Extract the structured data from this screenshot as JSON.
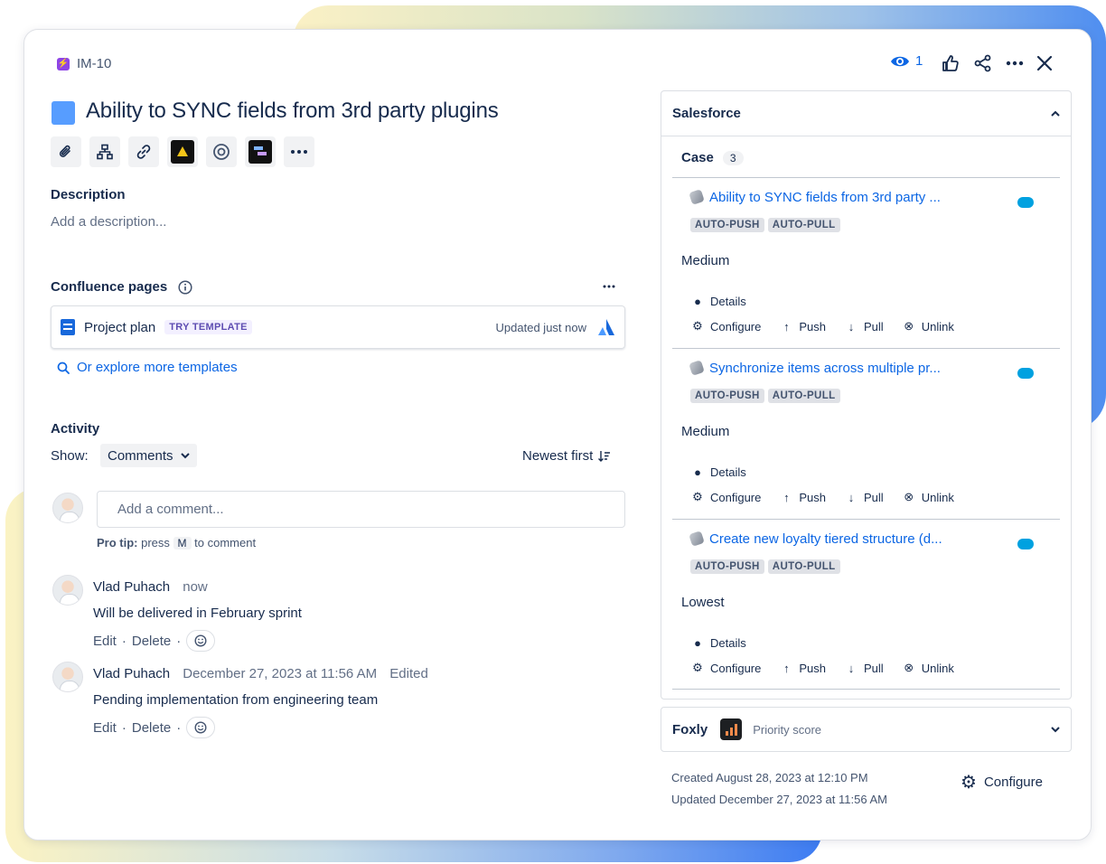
{
  "issue": {
    "key": "IM-10",
    "title": "Ability to SYNC fields from 3rd party plugins",
    "watch_count": "1",
    "description_label": "Description",
    "description_placeholder": "Add a description..."
  },
  "toolbar": [
    "paperclip-icon",
    "hierarchy-icon",
    "link-icon",
    "triangle-app-icon",
    "target-icon",
    "app-icon",
    "more-icon"
  ],
  "confluence": {
    "label": "Confluence pages",
    "page_title": "Project plan",
    "badge": "TRY TEMPLATE",
    "updated": "Updated just now",
    "explore": "Or explore more templates"
  },
  "activity": {
    "label": "Activity",
    "show_label": "Show:",
    "filter": "Comments",
    "sort": "Newest first",
    "comment_placeholder": "Add a comment...",
    "pro_tip_label": "Pro tip:",
    "pro_tip_press": "press",
    "pro_tip_key": "M",
    "pro_tip_tail": "to comment",
    "edit": "Edit",
    "delete": "Delete",
    "separator": "·",
    "comments": [
      {
        "author": "Vlad Puhach",
        "time": "now",
        "edited": "",
        "text": "Will be delivered in February sprint"
      },
      {
        "author": "Vlad Puhach",
        "time": "December 27, 2023 at 11:56 AM",
        "edited": "Edited",
        "text": "Pending implementation from engineering team"
      }
    ]
  },
  "salesforce": {
    "title": "Salesforce",
    "case_label": "Case",
    "case_count": "3",
    "tag_push": "AUTO-PUSH",
    "tag_pull": "AUTO-PULL",
    "actions": {
      "details": "Details",
      "configure": "Configure",
      "push": "Push",
      "pull": "Pull",
      "unlink": "Unlink"
    },
    "items": [
      {
        "title": "Ability to SYNC fields from 3rd party ...",
        "priority": "Medium"
      },
      {
        "title": "Synchronize items across multiple pr...",
        "priority": "Medium"
      },
      {
        "title": "Create new loyalty tiered structure (d...",
        "priority": "Lowest"
      }
    ]
  },
  "foxly": {
    "title": "Foxly",
    "subtitle": "Priority score"
  },
  "footer": {
    "created": "Created August 28, 2023 at 12:10 PM",
    "updated": "Updated December 27, 2023 at 11:56 AM",
    "configure": "Configure"
  },
  "colors": {
    "accent": "#0c66e4",
    "title_swatch": "#579dff",
    "key_icon": "#8e44e6"
  }
}
